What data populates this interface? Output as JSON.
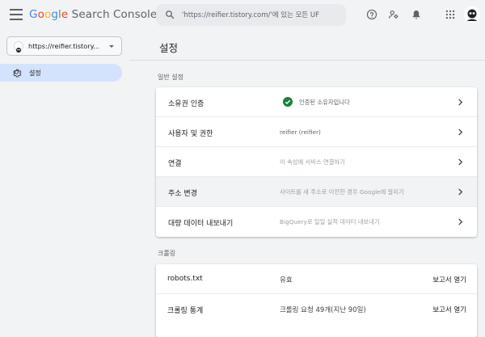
{
  "header": {
    "logo_google": [
      "G",
      "o",
      "o",
      "g",
      "l",
      "e"
    ],
    "logo_product": "Search Console",
    "search_placeholder": "'https://reifier.tistory.com/'에 있는 모든 UF"
  },
  "sidebar": {
    "property": "https://reifier.tistory...",
    "items": [
      {
        "label": "설정",
        "icon": "gear-icon",
        "selected": true
      }
    ]
  },
  "main": {
    "title": "설정",
    "general_section_title": "일반 설정",
    "general_rows": [
      {
        "label": "소유권 인증",
        "value": "인증된 소유자입니다",
        "status": "verified"
      },
      {
        "label": "사용자 및 권한",
        "value": "reifier (reifier)"
      },
      {
        "label": "연결",
        "value": "이 속성에 서비스 연결하기"
      },
      {
        "label": "주소 변경",
        "value": "사이트를 새 주소로 이전한 경우 Google에 알리기"
      },
      {
        "label": "대량 데이터 내보내기",
        "value": "BigQuery로 일일 실적 데이터 내보내기"
      }
    ],
    "crawl_section_title": "크롤링",
    "crawl_rows": [
      {
        "label": "robots.txt",
        "value": "유효",
        "link": "보고서 열기"
      },
      {
        "label": "크롤링 통계",
        "value": "크롤링 요청 49개(지난 90일)",
        "link": "보고서 열기"
      }
    ]
  },
  "colors": {
    "accent": "#1a73e8",
    "selected_nav": "#d3e3fd",
    "verified": "#188038"
  }
}
